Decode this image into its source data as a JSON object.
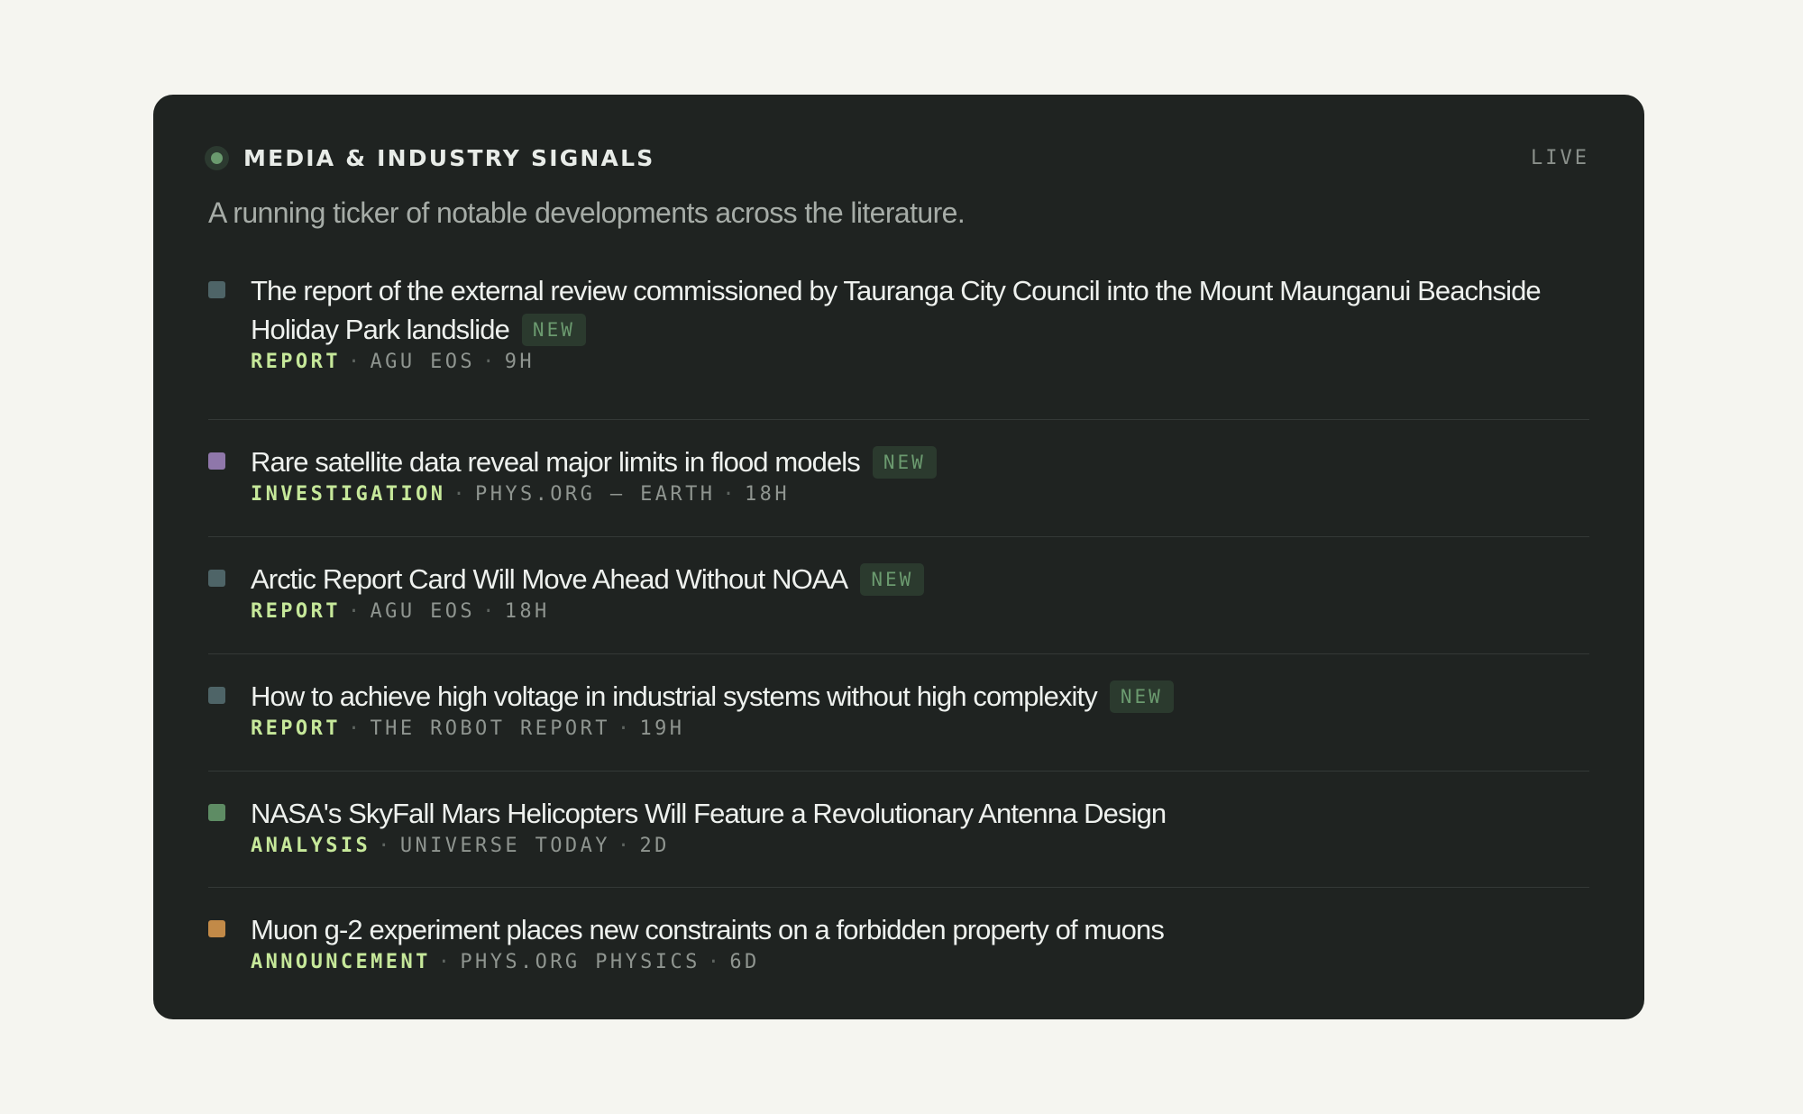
{
  "header": {
    "title": "MEDIA & INDUSTRY SIGNALS",
    "status": "LIVE",
    "subtitle": "A running ticker of notable developments across the literature."
  },
  "colors": {
    "report": "#4e6467",
    "investigation": "#8f77aa",
    "analysis": "#5e8c64",
    "announcement": "#c28a48"
  },
  "items": [
    {
      "headline": "The report of the external review commissioned by Tauranga City Council into the Mount Maunganui Beachside Holiday Park landslide",
      "badge": "NEW",
      "type": "REPORT",
      "source": "AGU EOS",
      "age": "9H",
      "marker_color": "#4e6467"
    },
    {
      "headline": "Rare satellite data reveal major limits in flood models",
      "badge": "NEW",
      "type": "INVESTIGATION",
      "source": "PHYS.ORG — EARTH",
      "age": "18H",
      "marker_color": "#8f77aa"
    },
    {
      "headline": "Arctic Report Card Will Move Ahead Without NOAA",
      "badge": "NEW",
      "type": "REPORT",
      "source": "AGU EOS",
      "age": "18H",
      "marker_color": "#4e6467"
    },
    {
      "headline": "How to achieve high voltage in industrial systems without high complexity",
      "badge": "NEW",
      "type": "REPORT",
      "source": "THE ROBOT REPORT",
      "age": "19H",
      "marker_color": "#4e6467"
    },
    {
      "headline": "NASA's SkyFall Mars Helicopters Will Feature a Revolutionary Antenna Design",
      "badge": "",
      "type": "ANALYSIS",
      "source": "UNIVERSE TODAY",
      "age": "2D",
      "marker_color": "#5e8c64"
    },
    {
      "headline": "Muon g-2 experiment places new constraints on a forbidden property of muons",
      "badge": "",
      "type": "ANNOUNCEMENT",
      "source": "PHYS.ORG PHYSICS",
      "age": "6D",
      "marker_color": "#c28a48"
    }
  ]
}
